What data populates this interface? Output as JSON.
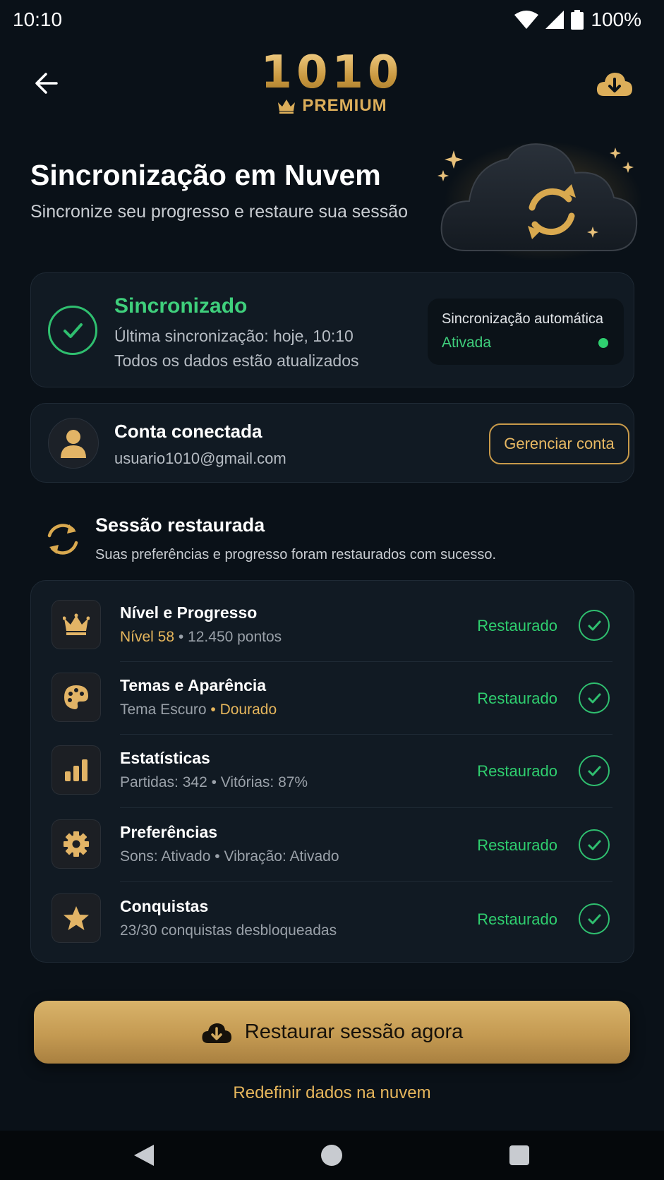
{
  "status_bar": {
    "time": "10:10",
    "battery": "100%"
  },
  "header": {
    "logo_number": "1010",
    "logo_tier": "PREMIUM",
    "back_icon": "arrow-left-icon",
    "download_icon": "cloud-download-icon"
  },
  "hero": {
    "title": "Sincronização em Nuvem",
    "subtitle": "Sincronize seu progresso e restaure sua sessão"
  },
  "sync_status": {
    "title": "Sincronizado",
    "last_sync": "Última sincronização: hoje, 10:10",
    "detail": "Todos os dados estão atualizados",
    "auto_label": "Sincronização automática",
    "auto_status": "Ativada"
  },
  "account": {
    "title": "Conta conectada",
    "email": "usuario1010@gmail.com",
    "manage_label": "Gerenciar conta"
  },
  "session": {
    "title": "Sessão restaurada",
    "description": "Suas preferências e progresso foram restaurados com sucesso."
  },
  "items": [
    {
      "icon": "crown-icon",
      "title": "Nível e Progresso",
      "sub_highlight": "Nível 58",
      "sub_rest": " • 12.450 pontos",
      "status": "Restaurado"
    },
    {
      "icon": "palette-icon",
      "title": "Temas e Aparência",
      "sub_rest_first": "Tema Escuro ",
      "sub_highlight": "• Dourado",
      "status": "Restaurado"
    },
    {
      "icon": "bar-chart-icon",
      "title": "Estatísticas",
      "sub": "Partidas: 342 • Vitórias: 87%",
      "status": "Restaurado"
    },
    {
      "icon": "gear-icon",
      "title": "Preferências",
      "sub": "Sons: Ativado • Vibração: Ativado",
      "status": "Restaurado"
    },
    {
      "icon": "star-icon",
      "title": "Conquistas",
      "sub": "23/30 conquistas desbloqueadas",
      "status": "Restaurado"
    }
  ],
  "actions": {
    "restore_label": "Restaurar sessão agora",
    "reset_label": "Redefinir dados na nuvem"
  },
  "colors": {
    "background": "#0a1118",
    "gold": "#e6b65c",
    "success": "#2fcf6f",
    "card": "#111a23"
  }
}
